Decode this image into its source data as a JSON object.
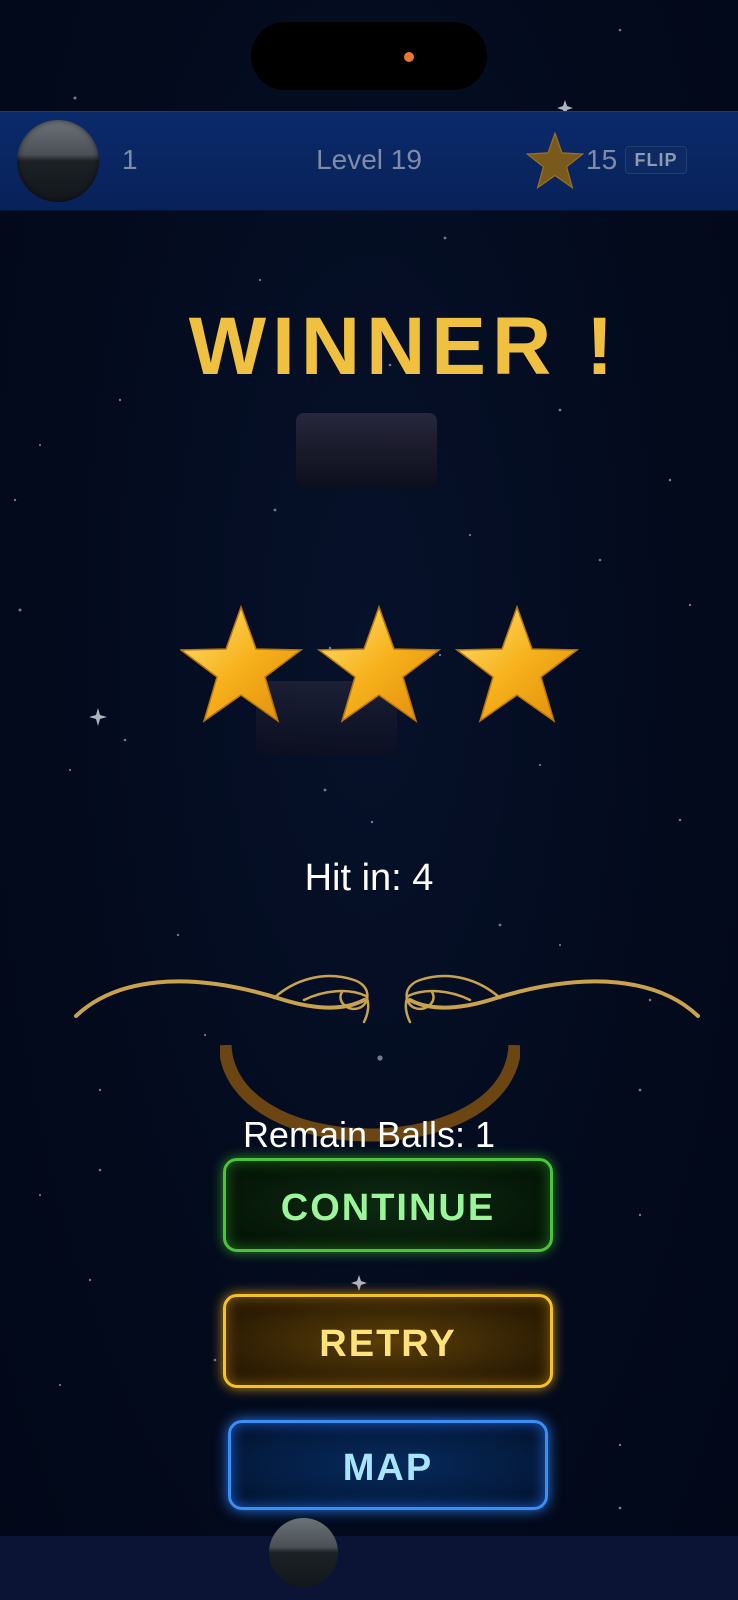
{
  "hud": {
    "balls_count": "1",
    "level_label": "Level 19",
    "stars_count": "15",
    "flip_label": "FLIP",
    "star_icon": "star-icon",
    "ball_icon": "ball-icon"
  },
  "result": {
    "title": "WINNER !",
    "stars_earned": 3,
    "stars_max": 3,
    "hit_text": "Hit in: 4",
    "remain_text": "Remain Balls: 1"
  },
  "buttons": {
    "continue_label": "CONTINUE",
    "retry_label": "RETRY",
    "map_label": "MAP"
  },
  "colors": {
    "title": "#f0c040",
    "continue": "#4cc33a",
    "retry": "#f5c224",
    "map": "#3a8ef5",
    "topbar": "#0b2a6b"
  }
}
